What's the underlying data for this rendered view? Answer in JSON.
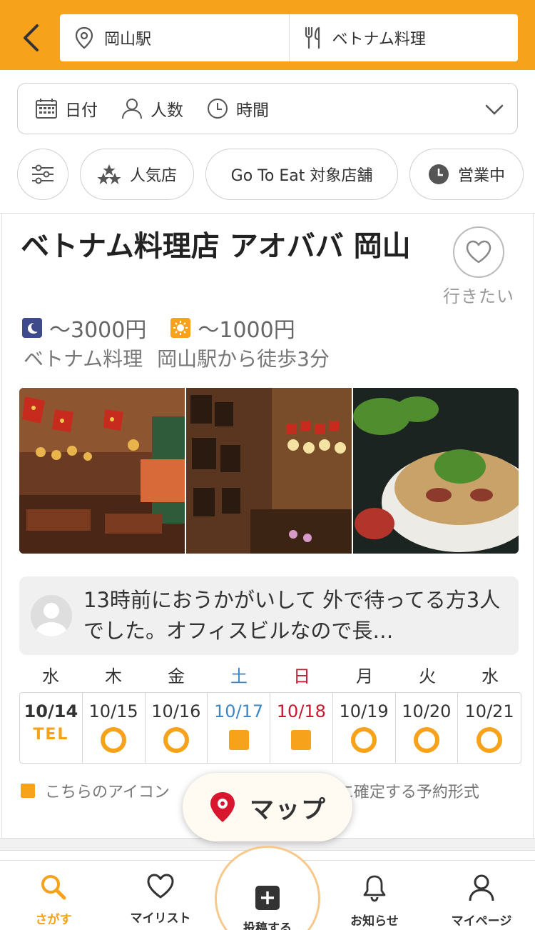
{
  "header": {
    "location": "岡山駅",
    "genre": "ベトナム料理"
  },
  "conditions": {
    "date_label": "日付",
    "people_label": "人数",
    "time_label": "時間"
  },
  "chips": {
    "popular": "人気店",
    "gotoeat": "Go To Eat 対象店舗",
    "open_now": "営業中"
  },
  "shop": {
    "name": "ベトナム料理店 アオババ 岡山",
    "favorite_label": "行きたい",
    "dinner_price": "～3000円",
    "lunch_price": "～1000円",
    "genre": "ベトナム料理",
    "access": "岡山駅から徒歩3分",
    "review": "13時前におうかがいして 外で待ってる方3人でした。オフィスビルなので長…"
  },
  "calendar": {
    "days": [
      {
        "dow": "水",
        "date": "10/14",
        "status": "TEL",
        "color": "#333333"
      },
      {
        "dow": "木",
        "date": "10/15",
        "status": "ring",
        "color": "#333333"
      },
      {
        "dow": "金",
        "date": "10/16",
        "status": "ring",
        "color": "#333333"
      },
      {
        "dow": "土",
        "date": "10/17",
        "status": "square",
        "color": "#3d86c6"
      },
      {
        "dow": "日",
        "date": "10/18",
        "status": "square",
        "color": "#c8182d"
      },
      {
        "dow": "月",
        "date": "10/19",
        "status": "ring",
        "color": "#333333"
      },
      {
        "dow": "火",
        "date": "10/20",
        "status": "ring",
        "color": "#333333"
      },
      {
        "dow": "水",
        "date": "10/21",
        "status": "ring",
        "color": "#333333"
      }
    ],
    "legend_part1": "こちらのアイコン",
    "legend_part2": "後に確定する予約形式"
  },
  "map_button": "マップ",
  "nav": {
    "search": "さがす",
    "mylist": "マイリスト",
    "post": "投稿する",
    "notify": "お知らせ",
    "mypage": "マイページ"
  },
  "colors": {
    "accent": "#f7a21b",
    "saturday": "#3d86c6",
    "sunday": "#c8182d",
    "map_pin": "#d8172f"
  }
}
